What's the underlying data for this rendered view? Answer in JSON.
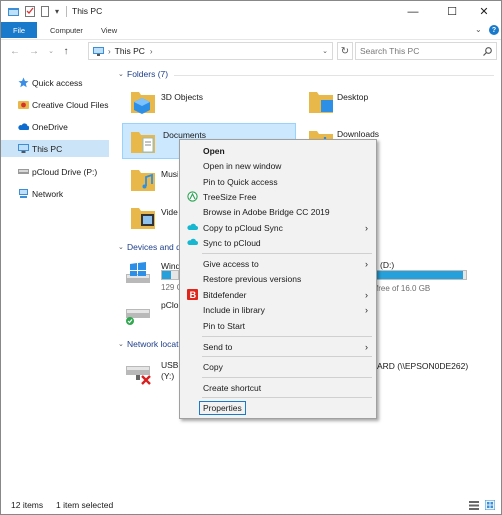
{
  "window": {
    "title": "This PC",
    "controls": {
      "minimize": "—",
      "maximize": "☐",
      "close": "✕"
    }
  },
  "ribbon": {
    "tabs": [
      "File",
      "Computer",
      "View"
    ],
    "help": "?"
  },
  "address": {
    "path": "This PC",
    "search_placeholder": "Search This PC"
  },
  "sidebar": {
    "items": [
      {
        "label": "Quick access",
        "icon": "star-icon"
      },
      {
        "label": "Creative Cloud Files",
        "icon": "creative-cloud-icon"
      },
      {
        "label": "OneDrive",
        "icon": "cloud-icon"
      },
      {
        "label": "This PC",
        "icon": "computer-icon"
      },
      {
        "label": "pCloud Drive (P:)",
        "icon": "drive-icon"
      },
      {
        "label": "Network",
        "icon": "network-icon"
      }
    ]
  },
  "main": {
    "folders_header": "Folders (7)",
    "folders": [
      {
        "name": "3D Objects"
      },
      {
        "name": "Desktop"
      },
      {
        "name": "Documents"
      },
      {
        "name": "Downloads"
      },
      {
        "name": "Music"
      },
      {
        "name": "Videos"
      }
    ],
    "devices_header": "Devices and drives",
    "devices": [
      {
        "name": "Windows (C:)",
        "detail": "129 GB free",
        "fill": 0.55
      },
      {
        "name": "(D:)",
        "detail": "free of 16.0 GB",
        "fill": 0.97
      },
      {
        "name": "pCloud Drive (P:)",
        "detail": ""
      }
    ],
    "network_header": "Network locations",
    "network": [
      {
        "name": "USBSHARE",
        "detail": "(Y:)",
        "extra": "ARD (\\\\EPSON0DE262)"
      }
    ]
  },
  "status": {
    "items": "12 items",
    "selected": "1 item selected"
  },
  "context_menu": {
    "open": "Open",
    "open_new_window": "Open in new window",
    "pin_quick_access": "Pin to Quick access",
    "treesize": "TreeSize Free",
    "bridge": "Browse in Adobe Bridge CC 2019",
    "copy_pcloud_sync": "Copy to pCloud Sync",
    "sync_pcloud": "Sync to pCloud",
    "give_access": "Give access to",
    "restore": "Restore previous versions",
    "bitdefender": "Bitdefender",
    "include_library": "Include in library",
    "pin_start": "Pin to Start",
    "send_to": "Send to",
    "copy": "Copy",
    "create_shortcut": "Create shortcut",
    "properties": "Properties"
  },
  "colors": {
    "accent": "#1979ca",
    "selection": "#cce8ff",
    "drive_fill": "#26a0da",
    "folder": "#e8b94a"
  }
}
